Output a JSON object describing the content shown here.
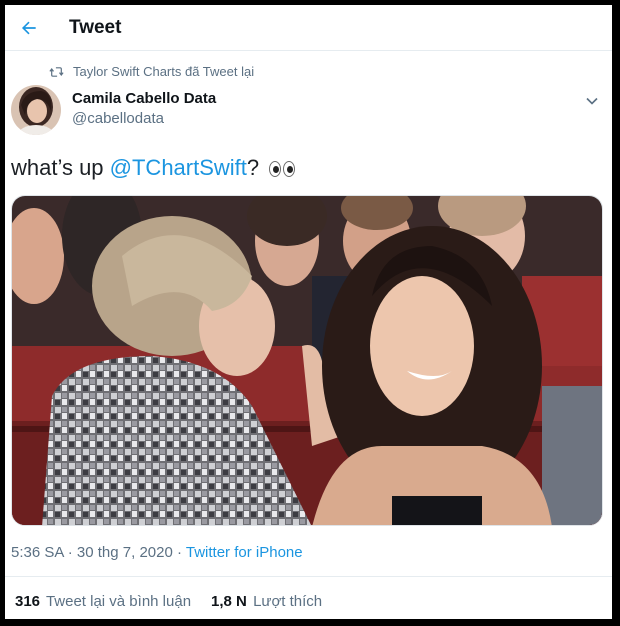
{
  "header": {
    "title": "Tweet"
  },
  "retweet": {
    "text": "Taylor Swift Charts đã Tweet lại"
  },
  "author": {
    "name": "Camila Cabello Data",
    "handle": "@cabellodata"
  },
  "tweet": {
    "text_before": "what’s up ",
    "mention": "@TChartSwift",
    "text_after": "? ",
    "emoji": "eyes"
  },
  "meta": {
    "time": "5:36 SA",
    "separator": " · ",
    "date": "30 thg 7, 2020",
    "source": "Twitter for iPhone"
  },
  "stats": [
    {
      "count": "316",
      "label": "Tweet lại và bình luận"
    },
    {
      "count": "1,8 N",
      "label": "Lượt thích"
    }
  ],
  "colors": {
    "accent": "#1b95e0",
    "secondary_text": "#5b7083",
    "border": "#e6ecf0"
  },
  "icons": [
    "back-arrow-icon",
    "retweet-icon",
    "chevron-down-icon"
  ]
}
